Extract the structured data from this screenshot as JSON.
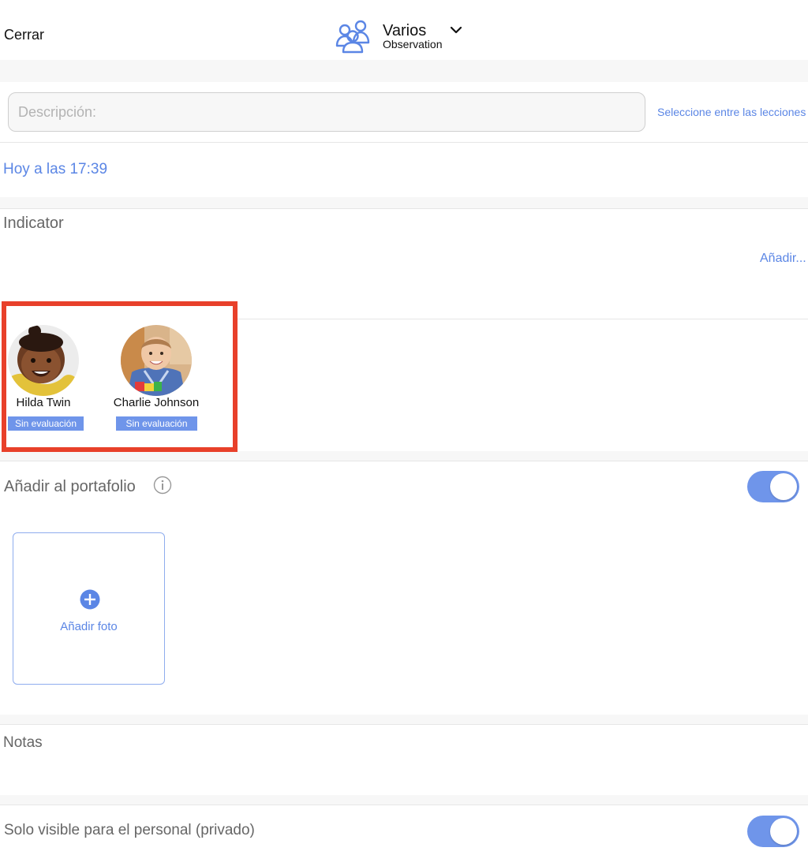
{
  "header": {
    "close_label": "Cerrar",
    "title": "Varios",
    "subtitle": "Observation",
    "icon": "group-icon"
  },
  "description": {
    "placeholder": "Descripción:",
    "value": ""
  },
  "lessons_link": "Seleccione entre las lecciones",
  "date_label": "Hoy a las 17:39",
  "indicator": {
    "label": "Indicator",
    "add_label": "Añadir..."
  },
  "children": [
    {
      "name": "Hilda Twin",
      "status": "Sin evaluación"
    },
    {
      "name": "Charlie Johnson",
      "status": "Sin evaluación"
    }
  ],
  "portfolio": {
    "label": "Añadir al portafolio",
    "enabled": true,
    "add_photo_label": "Añadir foto"
  },
  "notes_label": "Notas",
  "private": {
    "label": "Solo visible para el personal (privado)",
    "enabled": true
  },
  "colors": {
    "accent": "#5b86e5",
    "toggle": "#6f95ea",
    "highlight": "#e8402a"
  }
}
